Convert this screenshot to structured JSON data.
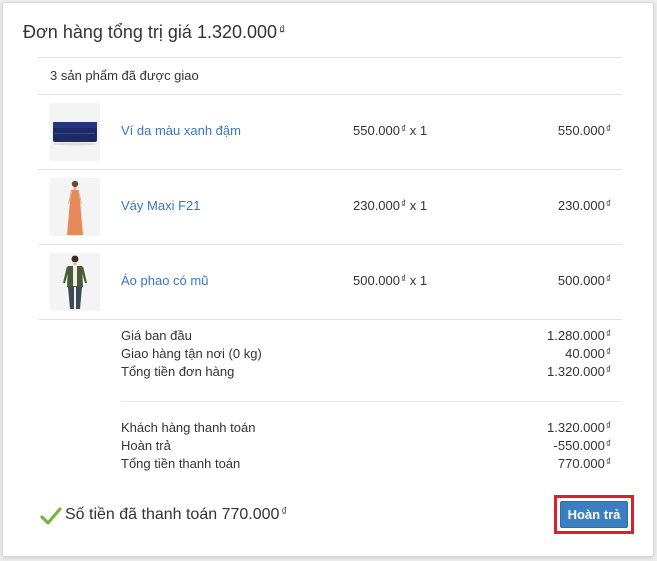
{
  "order": {
    "title_prefix": "Đơn hàng tổng trị giá",
    "title_amount": "1.320.000",
    "currency": "₫"
  },
  "shipment": {
    "status": "3 sản phẩm đã được giao"
  },
  "items": [
    {
      "name": "Ví da màu xanh đậm",
      "unit_price": "550.000",
      "qty_text": "x 1",
      "total": "550.000",
      "thumb_icon": "wallet-image"
    },
    {
      "name": "Váy Maxi F21",
      "unit_price": "230.000",
      "qty_text": "x 1",
      "total": "230.000",
      "thumb_icon": "dress-image"
    },
    {
      "name": "Áo phao có mũ",
      "unit_price": "500.000",
      "qty_text": "x 1",
      "total": "500.000",
      "thumb_icon": "vest-image"
    }
  ],
  "summary": {
    "subtotal_label": "Giá ban đầu",
    "subtotal_value": "1.280.000",
    "shipping_label": "Giao hàng tận nơi (0 kg)",
    "shipping_value": "40.000",
    "order_total_label": "Tổng tiền đơn hàng",
    "order_total_value": "1.320.000",
    "paid_label": "Khách hàng thanh toán",
    "paid_value": "1.320.000",
    "refund_label": "Hoàn trả",
    "refund_value": "-550.000",
    "net_label": "Tổng tiền thanh toán",
    "net_value": "770.000"
  },
  "footer": {
    "paid_message": "Số tiền đã thanh toán 770.000",
    "refund_button": "Hoàn trả"
  },
  "colors": {
    "link": "#3a76bd",
    "button": "#3a7fc1",
    "check": "#7cb342",
    "highlight": "#e01e2b"
  }
}
